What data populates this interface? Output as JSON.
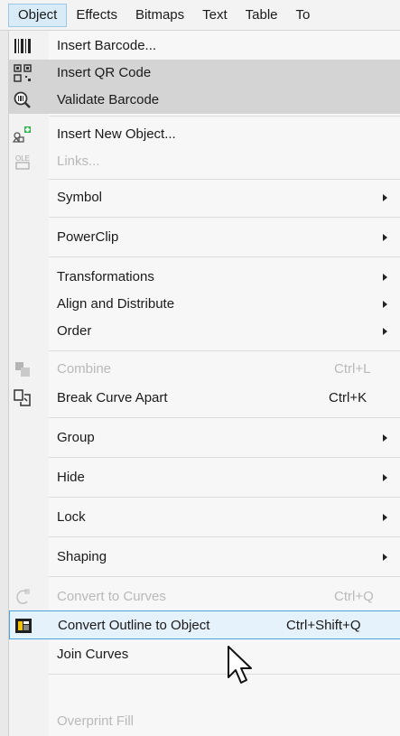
{
  "menubar": {
    "items": [
      {
        "label": "Object"
      },
      {
        "label": "Effects"
      },
      {
        "label": "Bitmaps"
      },
      {
        "label": "Text"
      },
      {
        "label": "Table"
      },
      {
        "label": "To"
      }
    ]
  },
  "menu": {
    "insert_barcode": "Insert Barcode...",
    "insert_qr_code": "Insert QR Code",
    "validate_barcode": "Validate Barcode",
    "insert_new_object": "Insert New Object...",
    "links": "Links...",
    "symbol": "Symbol",
    "powerclip": "PowerClip",
    "transformations": "Transformations",
    "align_distribute": "Align and Distribute",
    "order": "Order",
    "combine": "Combine",
    "combine_shortcut": "Ctrl+L",
    "break_curve_apart": "Break Curve Apart",
    "break_curve_apart_shortcut": "Ctrl+K",
    "group": "Group",
    "hide": "Hide",
    "lock": "Lock",
    "shaping": "Shaping",
    "convert_to_curves": "Convert to Curves",
    "convert_to_curves_shortcut": "Ctrl+Q",
    "convert_outline": "Convert Outline to Object",
    "convert_outline_shortcut": "Ctrl+Shift+Q",
    "join_curves": "Join Curves",
    "overprint_fill": "Overprint Fill"
  },
  "colors": {
    "selection_border": "#4aa3df",
    "hover_gray": "#d4d4d4",
    "disabled_text": "#b9b9b9"
  }
}
